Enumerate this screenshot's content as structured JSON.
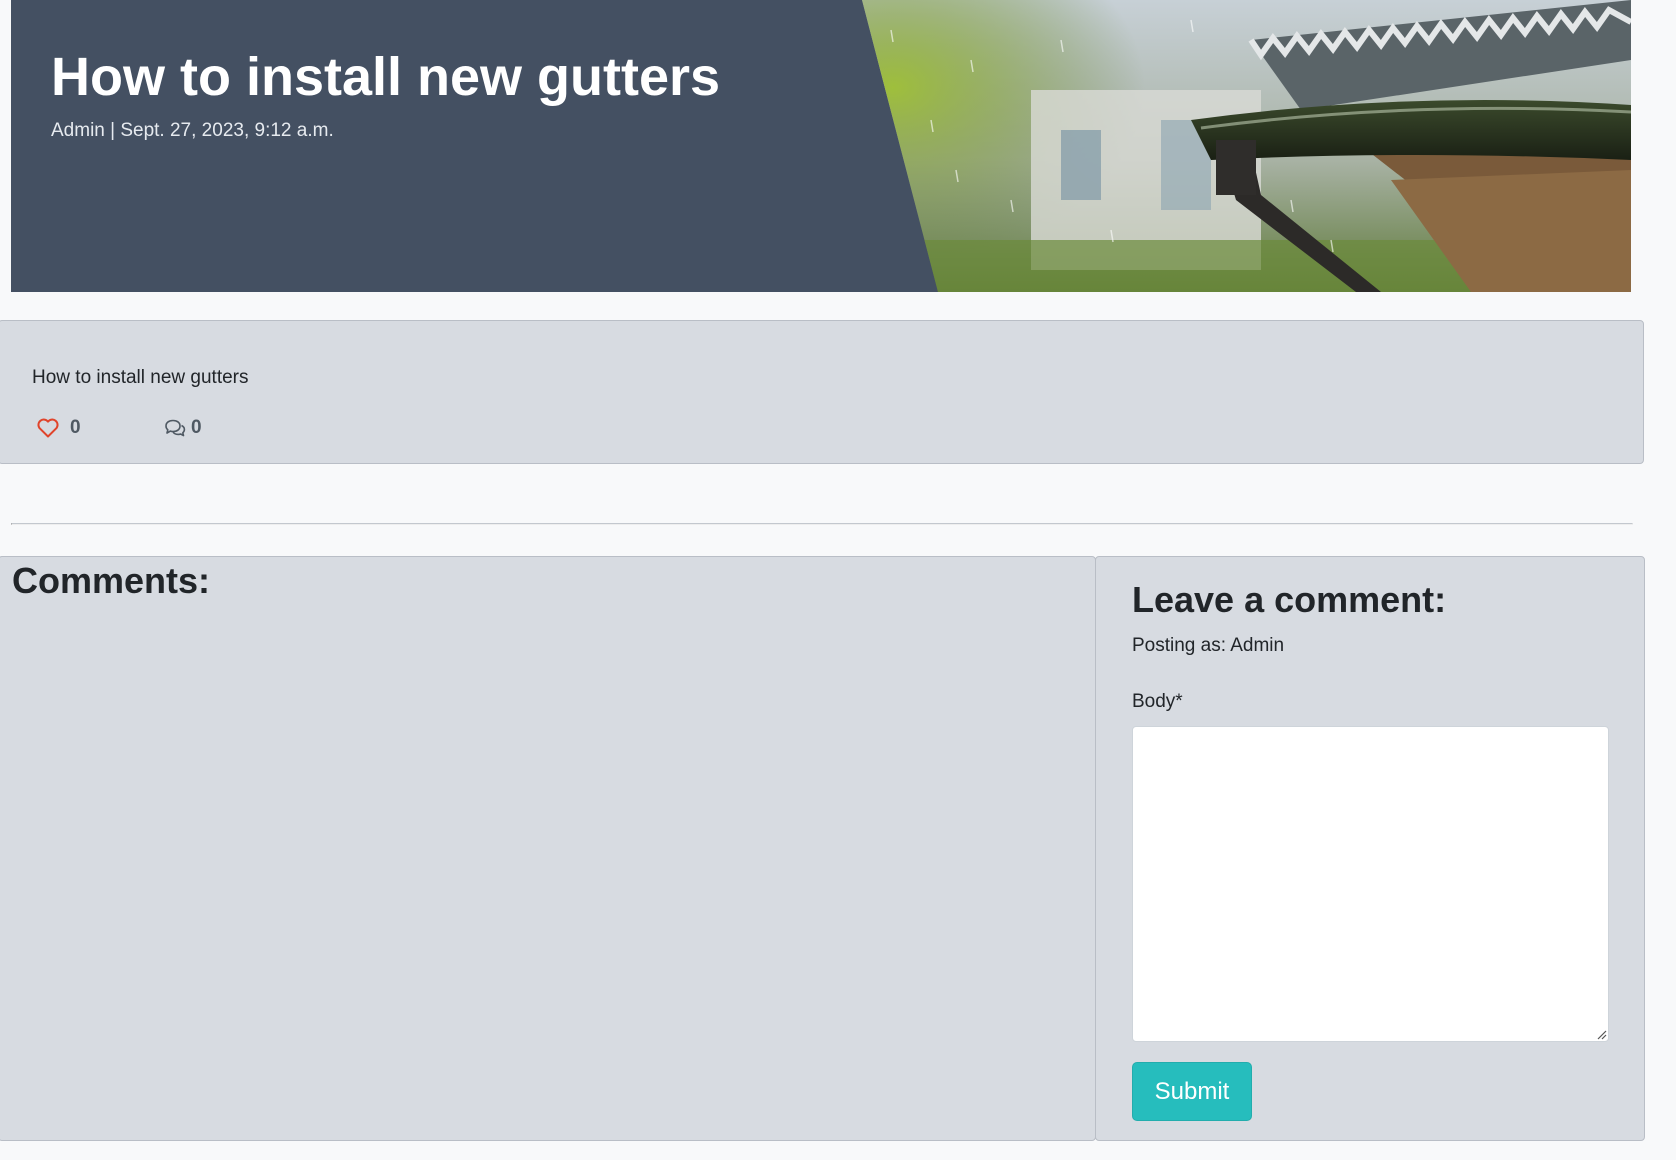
{
  "post": {
    "title": "How to install new gutters",
    "meta": "Admin | Sept. 27, 2023, 9:12 a.m.",
    "body": "How to install new gutters",
    "likes": "0",
    "comments_count": "0"
  },
  "comments_section": {
    "heading": "Comments:"
  },
  "comment_form": {
    "heading": "Leave a comment:",
    "posting_as": "Posting as: Admin",
    "body_label": "Body*",
    "body_value": "",
    "submit_label": "Submit"
  },
  "icons": {
    "like": "heart-outline-icon",
    "comments": "chat-bubbles-icon",
    "hero": "rain-gutter-photo"
  },
  "colors": {
    "hero_background": "#445062",
    "card_background": "#d7dbe1",
    "page_background": "#f8f9fa",
    "heart": "#e0442b",
    "submit_button": "#26bdbd"
  }
}
